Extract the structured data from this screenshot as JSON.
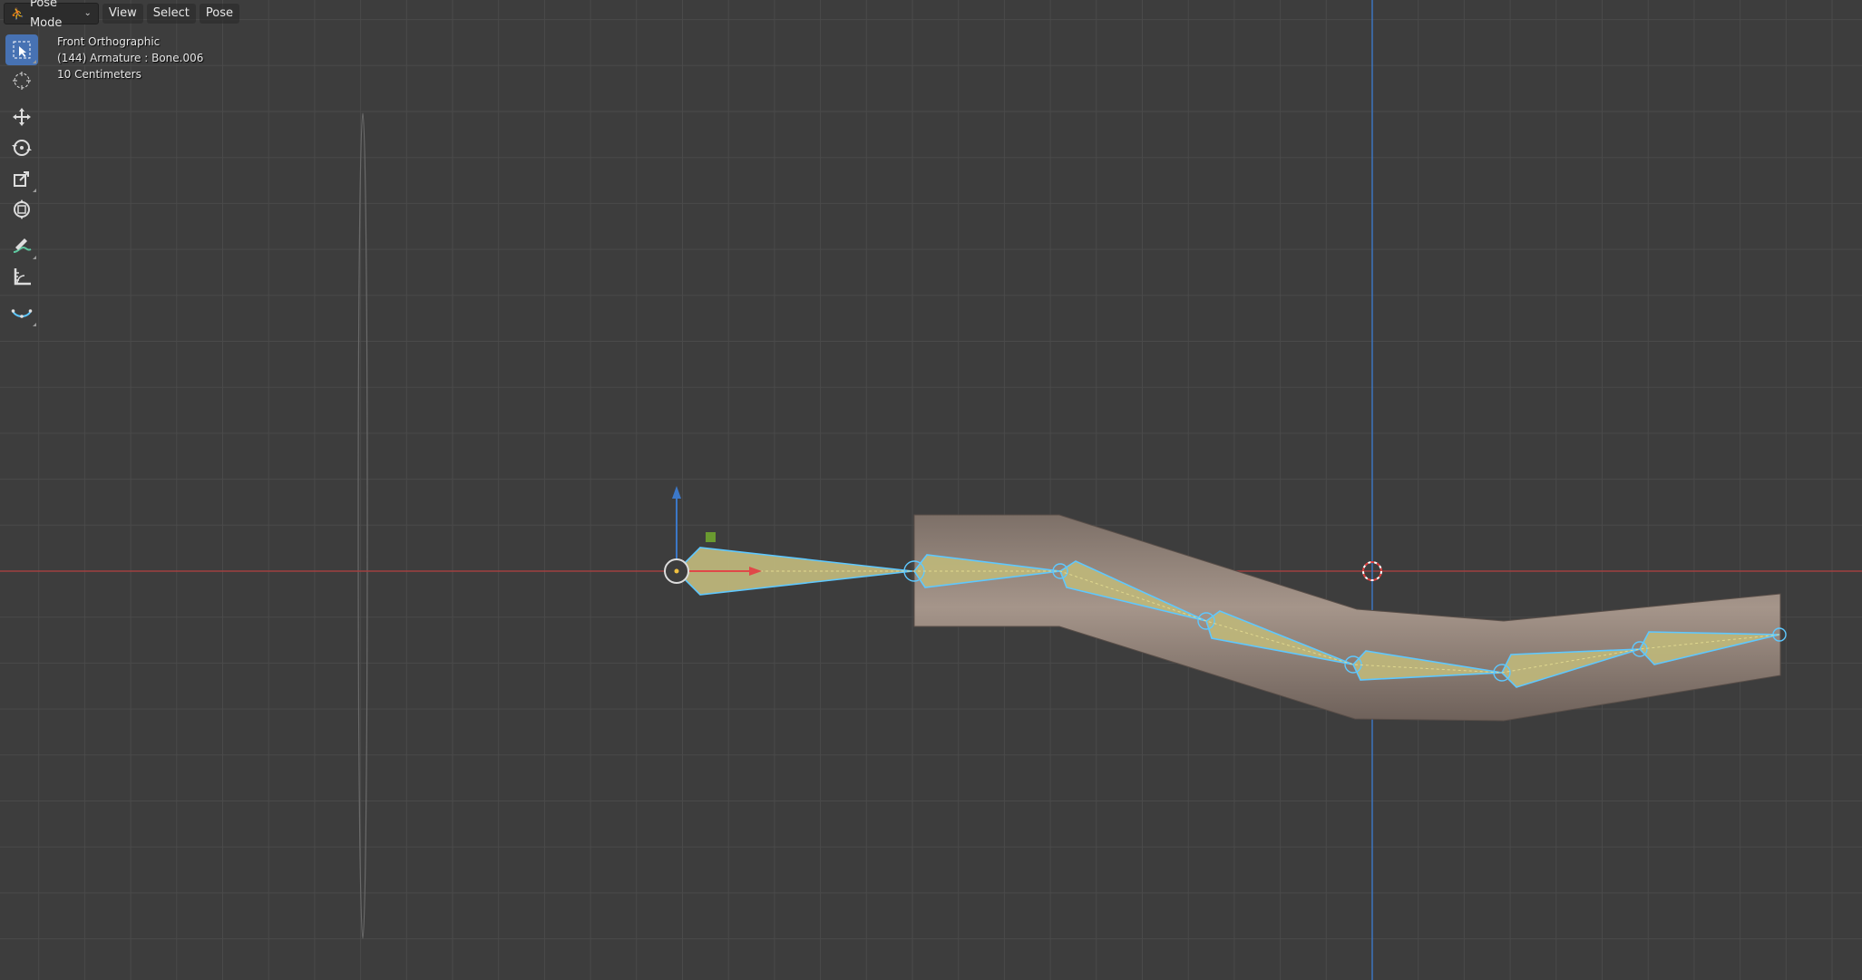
{
  "header": {
    "mode": "Pose Mode",
    "menus": [
      "View",
      "Select",
      "Pose"
    ]
  },
  "overlay": {
    "view_name": "Front Orthographic",
    "object_info": "(144) Armature : Bone.006",
    "grid_scale": "10 Centimeters"
  },
  "toolbar": {
    "tools": [
      "select-box",
      "cursor",
      "move",
      "rotate",
      "scale",
      "transform",
      "annotate",
      "measure",
      "bone-size"
    ],
    "active": "select-box"
  },
  "colors": {
    "background": "#3d3d3d",
    "grid": "#4a4a4a",
    "x_axis": "#a04040",
    "z_axis": "#3c78c8",
    "bone_fill": "#bdb57a",
    "bone_outline": "#5ec8ff",
    "mesh": "#8a7a6e",
    "accent": "#4772b3"
  }
}
